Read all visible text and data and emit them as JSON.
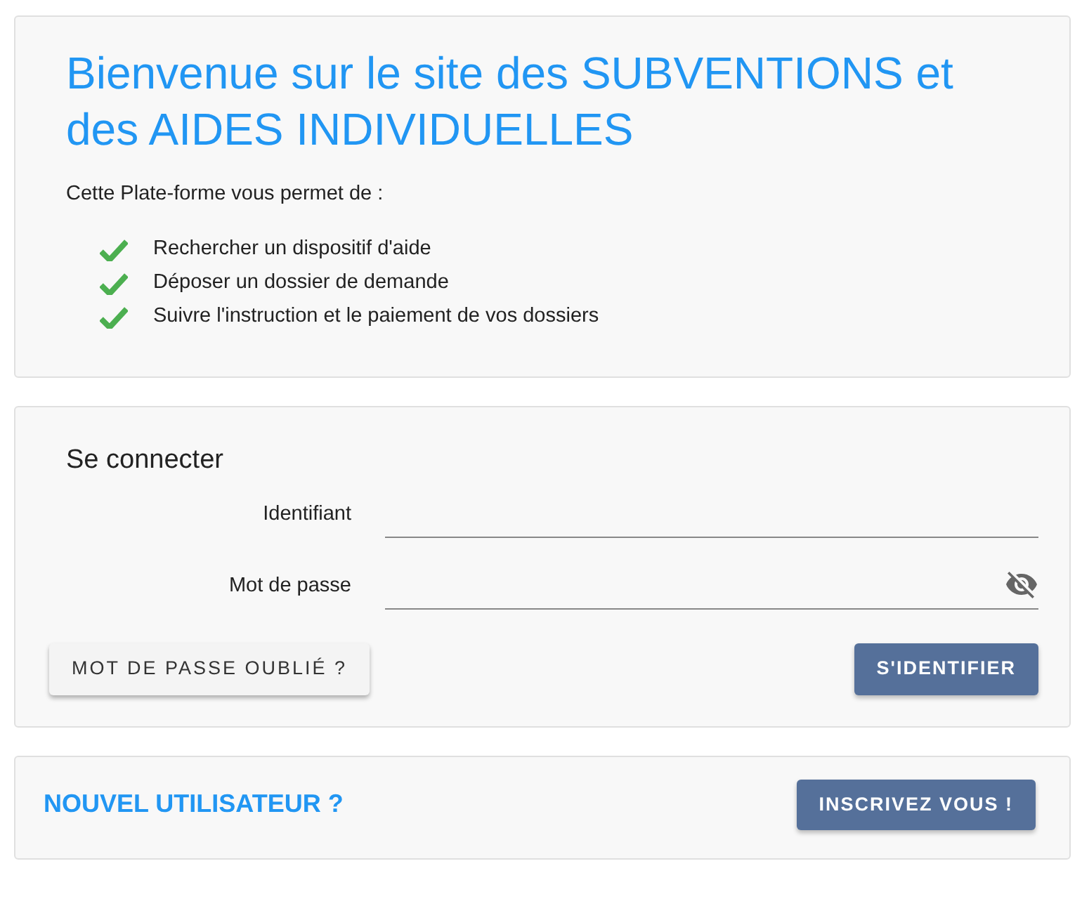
{
  "welcome": {
    "title": "Bienvenue sur le site des SUBVENTIONS et des AIDES INDIVIDUELLES",
    "intro": "Cette Plate-forme vous permet de :",
    "features": [
      "Rechercher un dispositif d'aide",
      "Déposer un dossier de demande",
      "Suivre l'instruction et le paiement de vos dossiers"
    ]
  },
  "login": {
    "title": "Se connecter",
    "fields": [
      {
        "label": "Identifiant",
        "kind": "text"
      },
      {
        "label": "Mot de passe",
        "kind": "password"
      }
    ],
    "forgot_button": "MOT DE PASSE OUBLIÉ ?",
    "submit_button": "S'IDENTIFIER"
  },
  "signup": {
    "title": "NOUVEL UTILISATEUR ?",
    "button": "INSCRIVEZ VOUS !"
  }
}
